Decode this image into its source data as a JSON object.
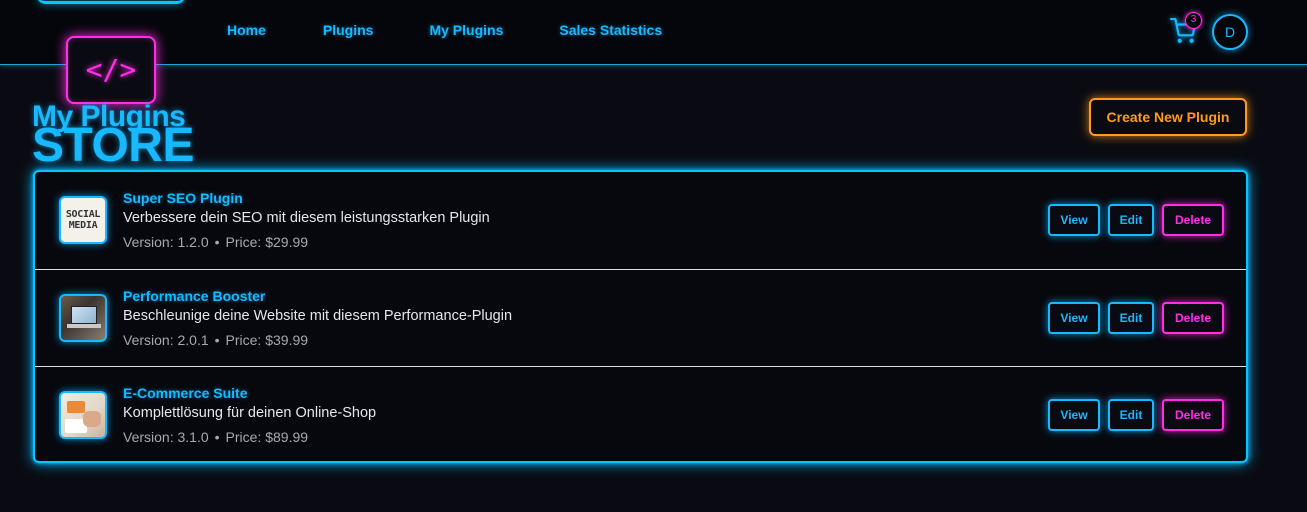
{
  "header": {
    "nav": [
      "Home",
      "Plugins",
      "My Plugins",
      "Sales Statistics"
    ],
    "cart_count": "3",
    "avatar_initial": "D"
  },
  "logo": {
    "symbol": "</>",
    "store_text": "STORE"
  },
  "page": {
    "title": "My Plugins",
    "create_button": "Create New Plugin"
  },
  "actions": {
    "view": "View",
    "edit": "Edit",
    "delete": "Delete"
  },
  "plugins": [
    {
      "name": "Super SEO Plugin",
      "description": "Verbessere dein SEO mit diesem leistungsstarken Plugin",
      "version": "Version: 1.2.0",
      "price": "Price: $29.99",
      "thumb_lines": [
        "SOCIAL",
        "MEDIA"
      ]
    },
    {
      "name": "Performance Booster",
      "description": "Beschleunige deine Website mit diesem Performance-Plugin",
      "version": "Version: 2.0.1",
      "price": "Price: $39.99"
    },
    {
      "name": "E-Commerce Suite",
      "description": "Komplettlösung für deinen Online-Shop",
      "version": "Version: 3.1.0",
      "price": "Price: $89.99"
    }
  ],
  "separator": "•",
  "colors": {
    "accent_cyan": "#19b9ff",
    "accent_magenta": "#ff2ee6",
    "accent_orange": "#ff9c1a",
    "background": "#0a0b12"
  }
}
